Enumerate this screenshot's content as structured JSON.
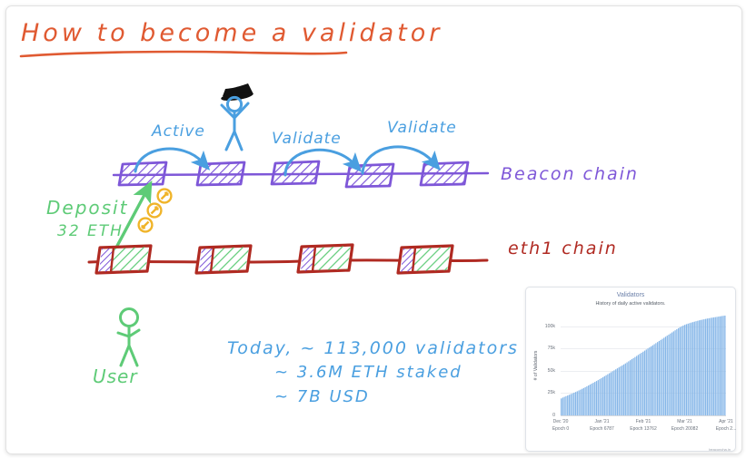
{
  "title": "How to become a validator",
  "beacon": {
    "chain_label": "Beacon chain",
    "arrow_labels": [
      "Active",
      "Validate",
      "Validate"
    ],
    "block_count": 5,
    "color": "#7e57d8"
  },
  "eth1": {
    "chain_label": "eth1 chain",
    "block_count": 4,
    "color": "#b02a22",
    "fill_color": "#5ecb77"
  },
  "deposit": {
    "label": "Deposit",
    "amount": "32 ETH",
    "color": "#5ecb77",
    "coin_count": 3,
    "coin_color": "#f0b429"
  },
  "user": {
    "label": "User",
    "color": "#5ecb77"
  },
  "validator_figure": {
    "name": "validator-stick-figure-with-top-hat",
    "body_color": "#4a9fe0",
    "hat_color": "#111111"
  },
  "stats": {
    "line_1": "Today, ~ 113,000  validators !",
    "line_2": "~ 3.6M  ETH  staked",
    "line_3": "~ 7B  USD",
    "color": "#4a9fe0"
  },
  "chart_data": {
    "type": "bar",
    "title": "Validators",
    "subtitle": "History of daily active validators.",
    "xlabel": "",
    "ylabel": "# of Validators",
    "ylim": [
      0,
      112000
    ],
    "yticks": [
      0,
      25000,
      50000,
      75000,
      100000
    ],
    "ytick_labels": [
      "0",
      "25k",
      "50k",
      "75k",
      "100k"
    ],
    "xtick_labels": [
      {
        "date": "Dec '20",
        "epoch": "Epoch 0"
      },
      {
        "date": "Jan '21",
        "epoch": "Epoch 6787"
      },
      {
        "date": "Feb '21",
        "epoch": "Epoch 13762"
      },
      {
        "date": "Mar '21",
        "epoch": "Epoch 20082"
      },
      {
        "date": "Apr '21",
        "epoch": "Epoch 2..."
      }
    ],
    "grid": true,
    "legend": "none",
    "bar_color": "#85b6e8",
    "watermark": "beaconcha.in",
    "values": [
      19000,
      20000,
      20800,
      21600,
      22300,
      23100,
      23900,
      24700,
      25500,
      26300,
      27100,
      28000,
      28900,
      29800,
      30700,
      31600,
      32600,
      33600,
      34600,
      35600,
      36600,
      37600,
      38600,
      39600,
      40700,
      41800,
      42900,
      44000,
      45100,
      46200,
      47300,
      48400,
      49500,
      50600,
      51700,
      52800,
      53900,
      55000,
      56100,
      57200,
      58300,
      59500,
      60700,
      61900,
      63100,
      64300,
      65500,
      66700,
      67900,
      69100,
      70300,
      71500,
      72700,
      73900,
      75100,
      76300,
      77500,
      78700,
      79900,
      81100,
      82300,
      83500,
      84700,
      85900,
      87100,
      88300,
      89500,
      90700,
      91900,
      93100,
      94300,
      95500,
      96700,
      97900,
      99000,
      100000,
      100900,
      101700,
      102400,
      103000,
      103600,
      104200,
      104700,
      105200,
      105700,
      106200,
      106700,
      107100,
      107500,
      107900,
      108300,
      108700,
      109000,
      109400,
      109700,
      110000,
      110300,
      110600,
      110900,
      111200,
      111500,
      111800,
      112000
    ]
  }
}
